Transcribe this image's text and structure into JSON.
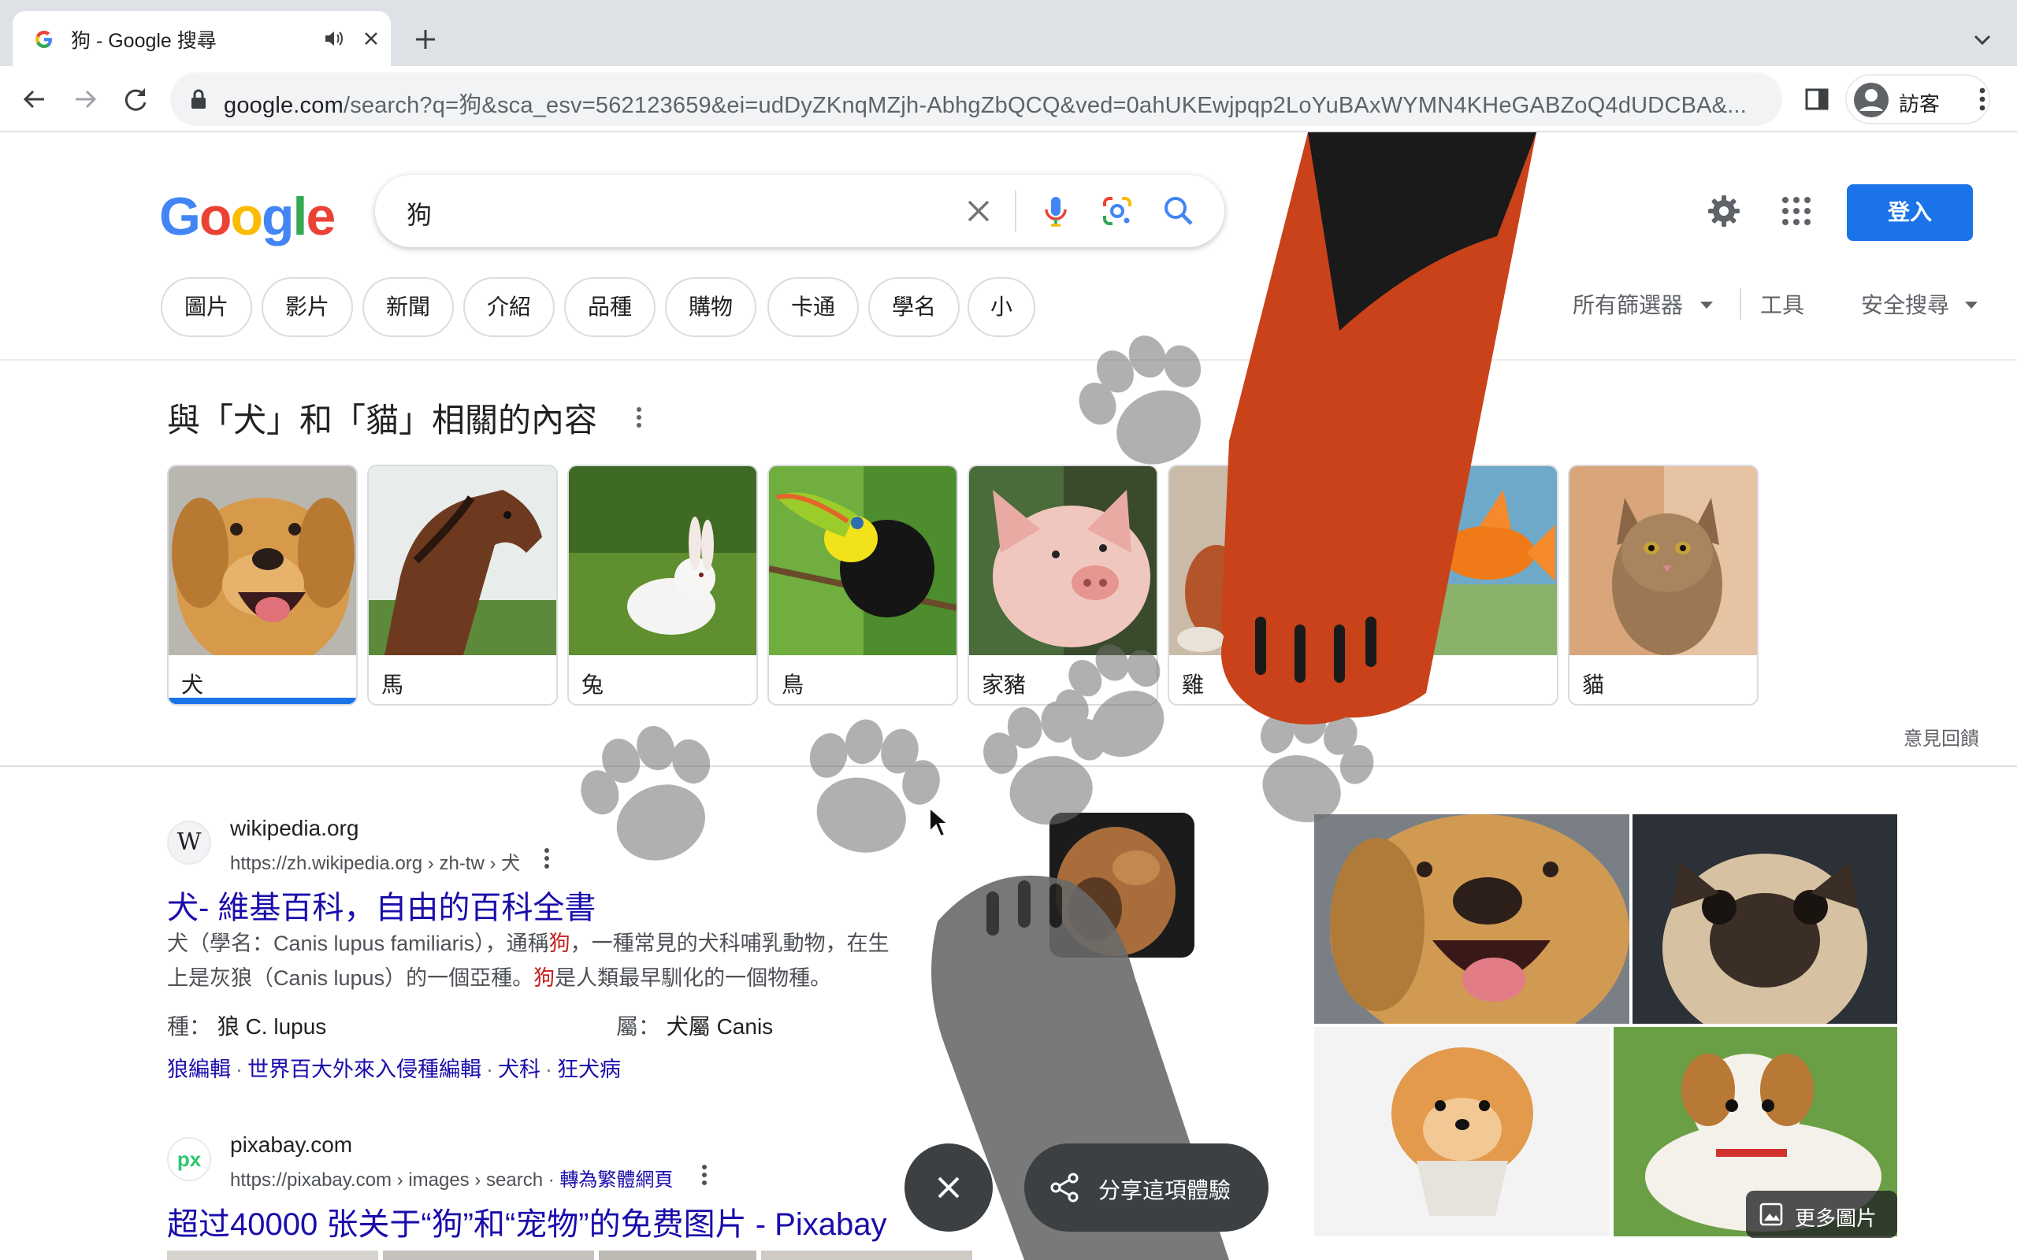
{
  "browser": {
    "tab_title": "狗 - Google 搜尋",
    "url_host": "google.com",
    "url_path": "/search?q=狗&sca_esv=562123659&ei=udDyZKnqMZjh-AbhgZbQCQ&ved=0ahUKEwjpqp2LoYuBAxWYMN4KHeGABZoQ4dUDCBA&...",
    "profile_label": "訪客"
  },
  "search": {
    "query": "狗",
    "signin_label": "登入",
    "chips": [
      "圖片",
      "影片",
      "新聞",
      "介紹",
      "品種",
      "購物",
      "卡通",
      "學名",
      "小"
    ],
    "all_filters": "所有篩選器",
    "tools": "工具",
    "safesearch": "安全搜尋"
  },
  "related": {
    "title": "與「犬」和「貓」相關的內容",
    "items": [
      {
        "label": "犬"
      },
      {
        "label": "馬"
      },
      {
        "label": "兔"
      },
      {
        "label": "鳥"
      },
      {
        "label": "家豬"
      },
      {
        "label": "雞"
      },
      {
        "label": ""
      },
      {
        "label": "貓"
      }
    ],
    "feedback": "意見回饋"
  },
  "results": [
    {
      "icon_letter": "W",
      "site": "wikipedia.org",
      "url": "https://zh.wikipedia.org › zh-tw › 犬",
      "title": "犬- 維基百科，自由的百科全書",
      "snippet_1a": "犬（學名：Canis lupus familiaris），通稱",
      "snippet_1b": "狗",
      "snippet_1c": "，一種常見的犬科哺乳動物，在生",
      "snippet_2a": "上是灰狼（Canis lupus）的一個亞種。",
      "snippet_2b": "狗",
      "snippet_2c": "是人類最早馴化的一個物種。",
      "fact_1_key": "種：",
      "fact_1_val": "狼 C. lupus",
      "fact_2_key": "屬：",
      "fact_2_val": "犬屬 Canis",
      "sitelinks": [
        "狼編輯",
        "世界百大外來入侵種編輯",
        "犬科",
        "狂犬病"
      ]
    },
    {
      "icon_letter": "px",
      "site": "pixabay.com",
      "url": "https://pixabay.com › images › search",
      "translate": "轉為繁體網頁",
      "title": "超过40000 张关于“狗”和“宠物”的免费图片 - Pixabay"
    }
  ],
  "image_panel": {
    "more_images": "更多圖片"
  },
  "doodle": {
    "share_label": "分享這項體驗"
  },
  "colors": {
    "link": "#1a0dab",
    "accent": "#1a73e8",
    "highlight": "#c5221f"
  }
}
